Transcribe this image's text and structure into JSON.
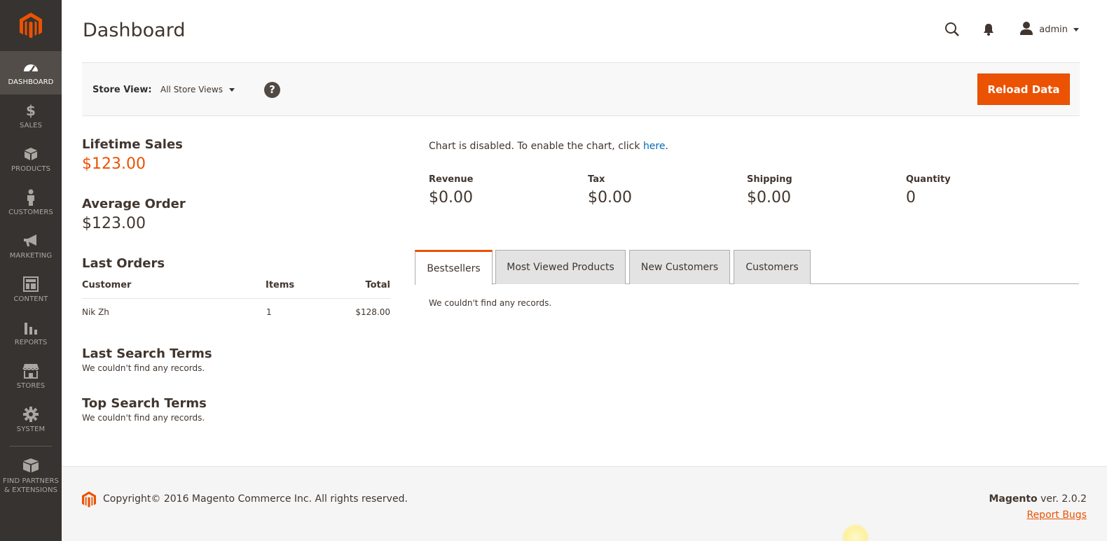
{
  "sidebar": {
    "items": [
      {
        "label": "DASHBOARD",
        "icon": "dashboard-icon",
        "active": true
      },
      {
        "label": "SALES",
        "icon": "dollar-icon"
      },
      {
        "label": "PRODUCTS",
        "icon": "box-icon"
      },
      {
        "label": "CUSTOMERS",
        "icon": "person-icon"
      },
      {
        "label": "MARKETING",
        "icon": "megaphone-icon"
      },
      {
        "label": "CONTENT",
        "icon": "layout-icon"
      },
      {
        "label": "REPORTS",
        "icon": "bar-chart-icon"
      },
      {
        "label": "STORES",
        "icon": "storefront-icon"
      },
      {
        "label": "SYSTEM",
        "icon": "gear-icon"
      }
    ],
    "partners": {
      "line1": "FIND PARTNERS",
      "line2": "& EXTENSIONS",
      "icon": "blocks-icon"
    }
  },
  "header": {
    "title": "Dashboard",
    "user": "admin"
  },
  "store_bar": {
    "label": "Store View:",
    "selected": "All Store Views",
    "help": "?",
    "reload_label": "Reload Data"
  },
  "left": {
    "lifetime_sales_title": "Lifetime Sales",
    "lifetime_sales_value": "$123.00",
    "average_order_title": "Average Order",
    "average_order_value": "$123.00",
    "last_orders_title": "Last Orders",
    "last_orders": {
      "columns": [
        "Customer",
        "Items",
        "Total"
      ],
      "rows": [
        {
          "customer": "Nik Zh",
          "items": "1",
          "total": "$128.00"
        }
      ]
    },
    "last_search_title": "Last Search Terms",
    "last_search_empty": "We couldn't find any records.",
    "top_search_title": "Top Search Terms",
    "top_search_empty": "We couldn't find any records."
  },
  "right": {
    "chart_msg_prefix": "Chart is disabled. To enable the chart, click ",
    "chart_msg_link": "here",
    "chart_msg_suffix": ".",
    "totals": [
      {
        "label": "Revenue",
        "value": "$0.00"
      },
      {
        "label": "Tax",
        "value": "$0.00"
      },
      {
        "label": "Shipping",
        "value": "$0.00"
      },
      {
        "label": "Quantity",
        "value": "0"
      }
    ],
    "tabs": [
      "Bestsellers",
      "Most Viewed Products",
      "New Customers",
      "Customers"
    ],
    "active_tab": "Bestsellers",
    "tab_content": "We couldn't find any records."
  },
  "footer": {
    "copyright": "Copyright© 2016 Magento Commerce Inc. All rights reserved.",
    "brand": "Magento",
    "version": " ver. 2.0.2",
    "report_bugs": "Report Bugs"
  },
  "colors": {
    "accent": "#eb5202",
    "sidebar_bg": "#373330",
    "sidebar_active": "#524d49",
    "link": "#006bb4"
  }
}
